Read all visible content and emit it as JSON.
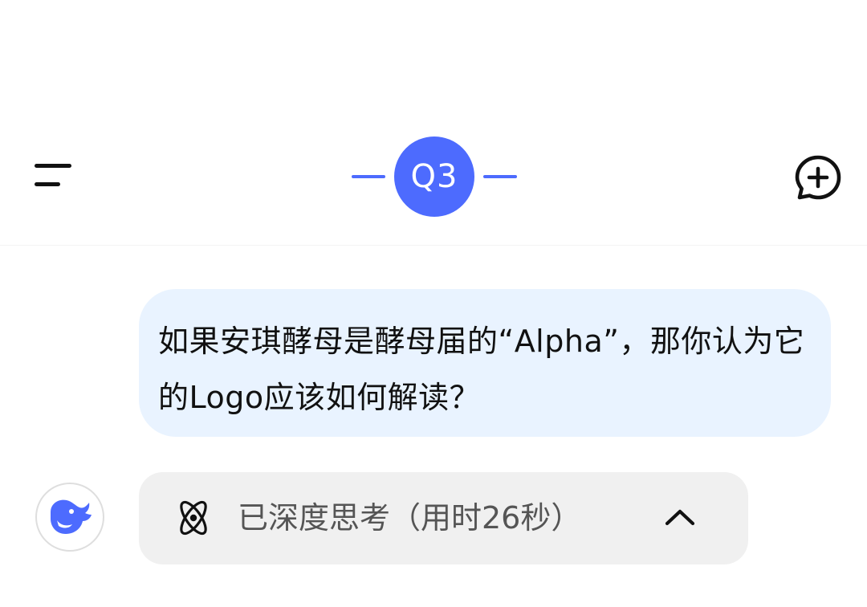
{
  "header": {
    "menu_icon": "hamburger-menu-icon",
    "title": "Q3",
    "accent_color": "#4d6bfe",
    "new_chat_icon": "chat-bubble-plus-icon"
  },
  "conversation": {
    "user_message": "如果安琪酵母是酵母届的“Alpha”，那你认为它的Logo应该如何解读？",
    "user_bubble_color": "#e9f3ff",
    "assistant_avatar_icon": "deepseek-whale-logo",
    "thinking": {
      "icon": "atom-icon",
      "label": "已深度思考（用时26秒）",
      "toggle_icon": "chevron-up-icon",
      "expanded": true
    }
  }
}
